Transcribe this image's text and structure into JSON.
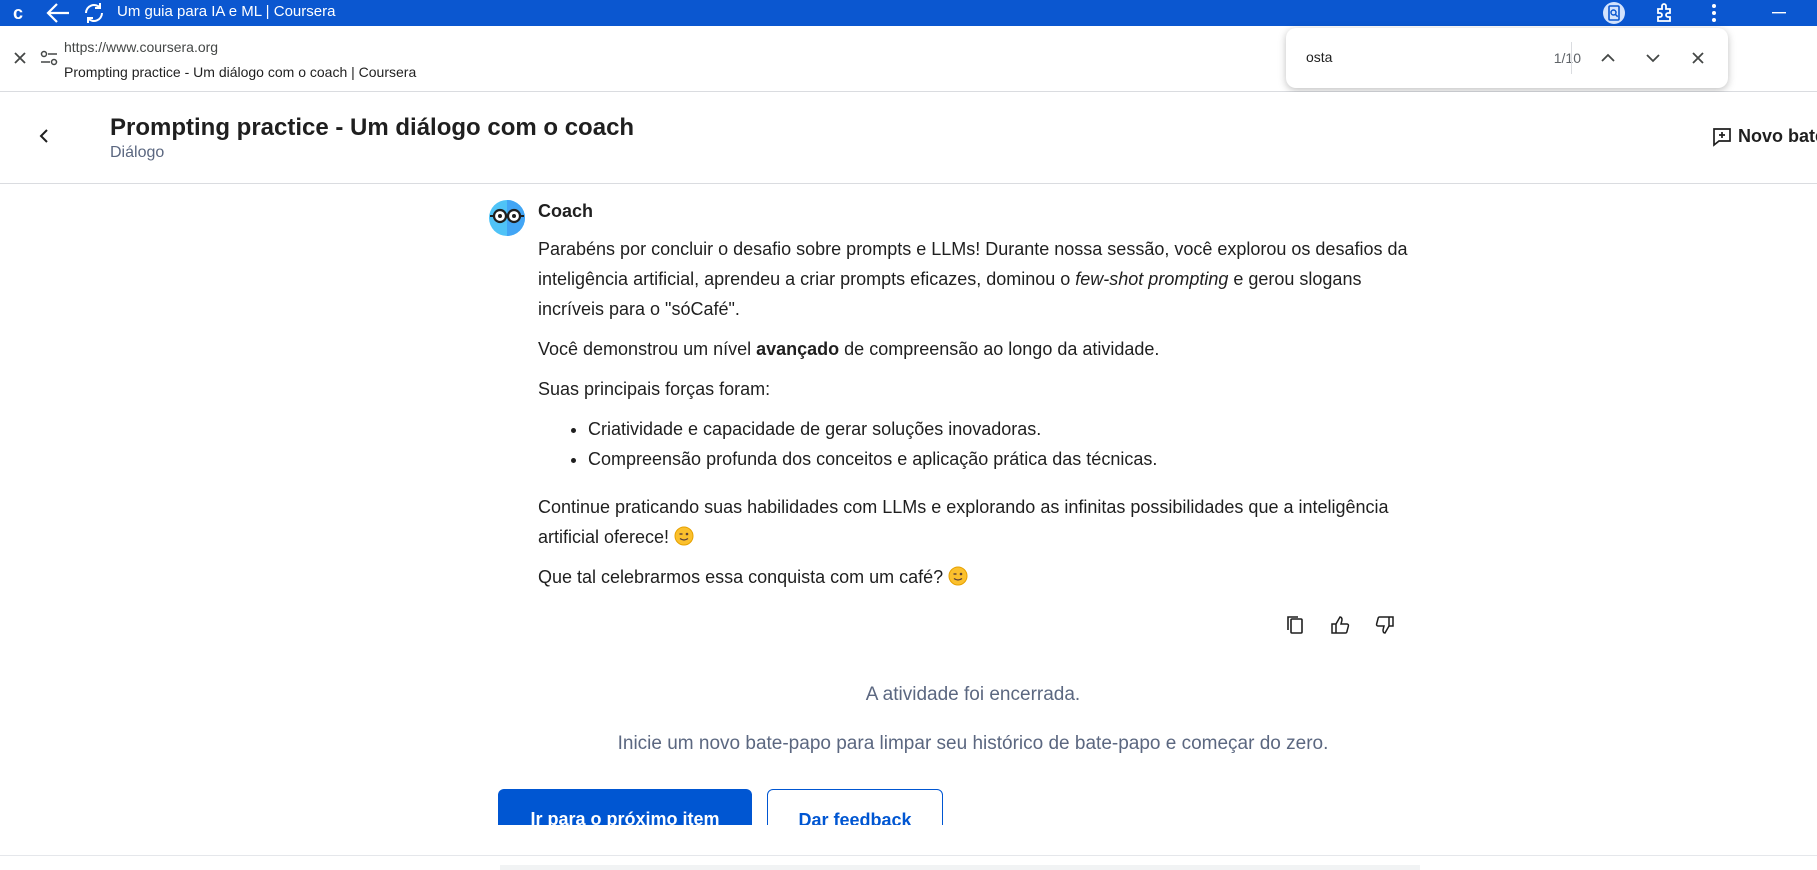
{
  "browser": {
    "tab_logo": "c",
    "window_title": "Um guia para IA e ML | Coursera",
    "url": "https://www.coursera.org",
    "page_title": "Prompting practice - Um diálogo com o coach | Coursera",
    "icons": [
      "back-arrow-icon",
      "reload-icon",
      "find-in-page-icon",
      "extensions-icon",
      "more-vert-icon",
      "minimize-icon",
      "close-icon",
      "site-settings-icon"
    ]
  },
  "find": {
    "query": "osta",
    "count": "1/10"
  },
  "header": {
    "title": "Prompting practice - Um diálogo com o coach",
    "subtitle": "Diálogo",
    "new_chat_label": "Novo bate"
  },
  "message": {
    "sender": "Coach",
    "p1_a": "Parabéns por concluir o desafio sobre prompts e LLMs! Durante nossa sessão, você explorou os desafios da inteligência artificial, aprendeu a criar prompts eficazes, dominou o ",
    "p1_em": "few-shot prompting",
    "p1_b": " e gerou slogans incríveis para o \"sóCafé\".",
    "p2_a": "Você demonstrou um nível ",
    "p2_strong": "avançado",
    "p2_b": " de compreensão ao longo da atividade.",
    "p3": "Suas principais forças foram:",
    "bullets": [
      "Criatividade e capacidade de gerar soluções inovadoras.",
      "Compreensão profunda dos conceitos e aplicação prática das técnicas."
    ],
    "p4": "Continue praticando suas habilidades com LLMs e explorando as infinitas possibilidades que a inteligência artificial oferece!",
    "p5": "Que tal celebrarmos essa conquista com um café?"
  },
  "status": {
    "ended": "A atividade foi encerrada.",
    "hint": "Inicie um novo bate-papo para limpar seu histórico de bate-papo e começar do zero."
  },
  "buttons": {
    "next_item": "Ir para o próximo item",
    "feedback": "Dar feedback"
  },
  "colors": {
    "brand_blue": "#0056d2",
    "chrome_blue": "#0b57d0",
    "muted_text": "#5b6780"
  }
}
